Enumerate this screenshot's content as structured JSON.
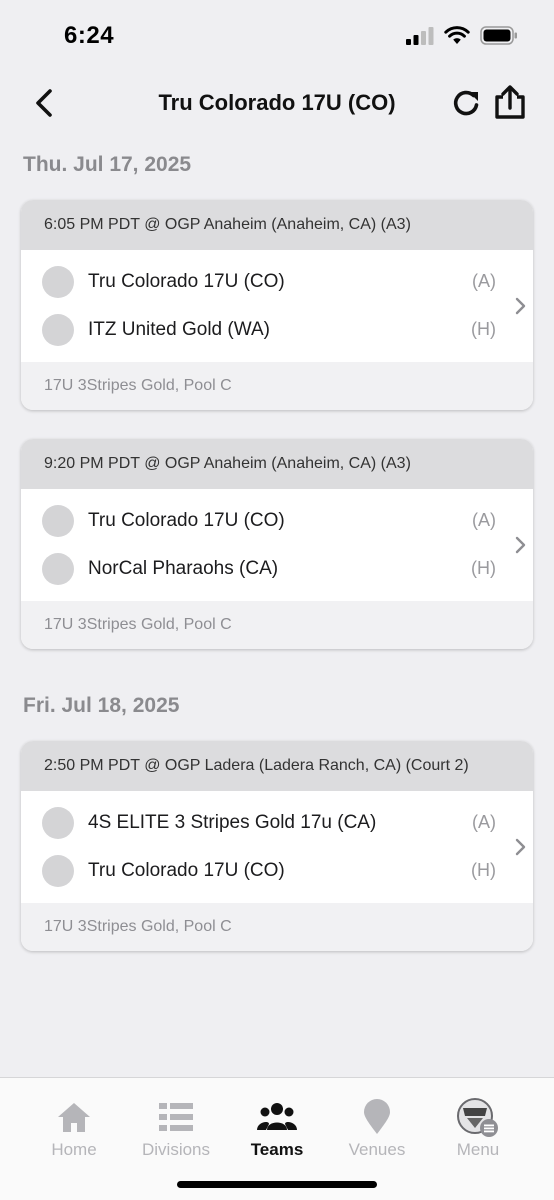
{
  "status": {
    "time": "6:24"
  },
  "header": {
    "title": "Tru Colorado 17U (CO)"
  },
  "days": [
    {
      "label": "Thu. Jul 17, 2025",
      "games": [
        {
          "time_venue": "6:05 PM PDT @ OGP Anaheim (Anaheim, CA) (A3)",
          "teams": [
            {
              "name": "Tru Colorado 17U (CO)",
              "side": "(A)"
            },
            {
              "name": "ITZ United Gold (WA)",
              "side": "(H)"
            }
          ],
          "division": "17U 3Stripes Gold, Pool C"
        },
        {
          "time_venue": "9:20 PM PDT @ OGP Anaheim (Anaheim, CA) (A3)",
          "teams": [
            {
              "name": "Tru Colorado 17U (CO)",
              "side": "(A)"
            },
            {
              "name": "NorCal Pharaohs (CA)",
              "side": "(H)"
            }
          ],
          "division": "17U 3Stripes Gold, Pool C"
        }
      ]
    },
    {
      "label": "Fri. Jul 18, 2025",
      "games": [
        {
          "time_venue": "2:50 PM PDT @ OGP Ladera (Ladera Ranch, CA) (Court 2)",
          "teams": [
            {
              "name": "4S ELITE 3 Stripes Gold 17u (CA)",
              "side": "(A)"
            },
            {
              "name": "Tru Colorado 17U (CO)",
              "side": "(H)"
            }
          ],
          "division": "17U 3Stripes Gold, Pool C"
        }
      ]
    }
  ],
  "tabs": [
    {
      "label": "Home",
      "icon": "home-icon",
      "active": false
    },
    {
      "label": "Divisions",
      "icon": "divisions-icon",
      "active": false
    },
    {
      "label": "Teams",
      "icon": "teams-icon",
      "active": true
    },
    {
      "label": "Venues",
      "icon": "venues-icon",
      "active": false
    },
    {
      "label": "Menu",
      "icon": "menu-logo-icon",
      "active": false
    }
  ],
  "colors": {
    "active_tab": "#111111",
    "inactive_tab": "#b5b5b9",
    "card_header": "#dcdcde",
    "background": "#efeff2"
  }
}
